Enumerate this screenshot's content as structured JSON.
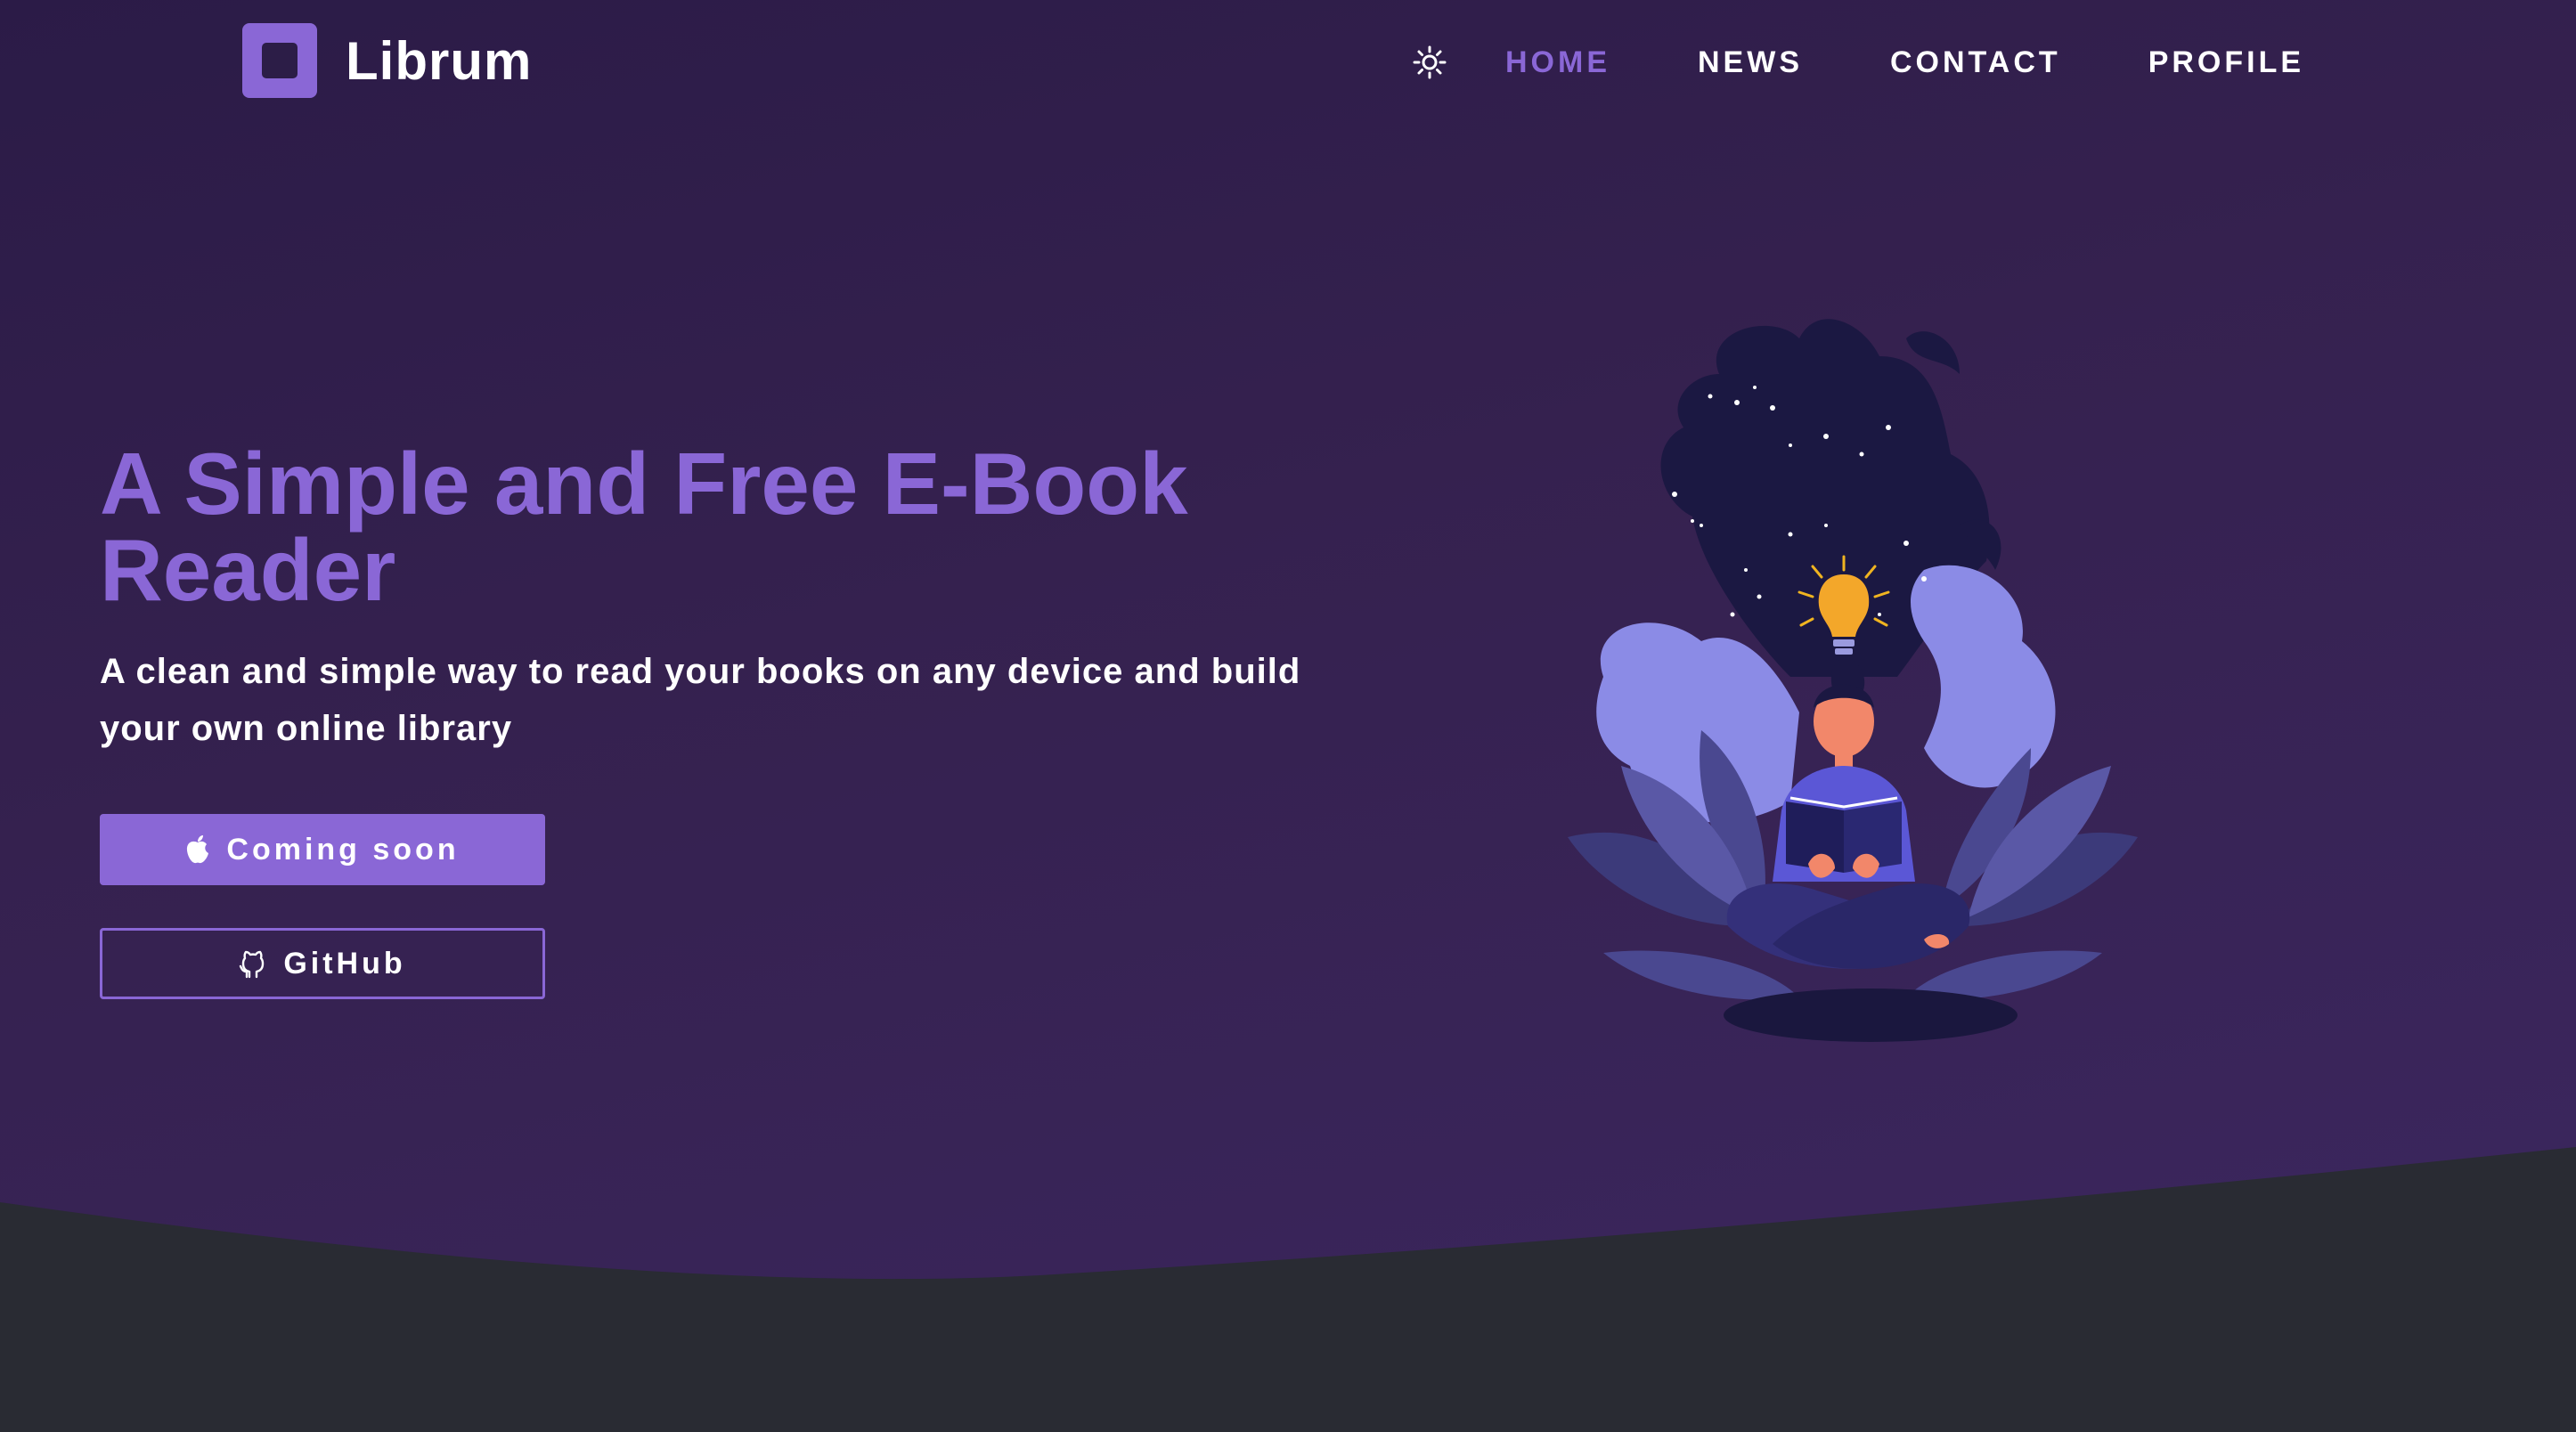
{
  "header": {
    "brand": "Librum",
    "nav": [
      {
        "label": "HOME",
        "active": true
      },
      {
        "label": "NEWS",
        "active": false
      },
      {
        "label": "CONTACT",
        "active": false
      },
      {
        "label": "PROFILE",
        "active": false
      }
    ],
    "theme_toggle_icon": "sun-icon"
  },
  "hero": {
    "title_line1": "A Simple and Free E-Book",
    "title_line2": "Reader",
    "subtitle_line1": "A clean and simple way to read your books on any device and build",
    "subtitle_line2": "your own online library",
    "primary_button": {
      "label": "Coming soon",
      "icon": "apple-icon"
    },
    "secondary_button": {
      "label": "GitHub",
      "icon": "github-icon"
    }
  },
  "colors": {
    "accent": "#8a67d6",
    "background_top": "#2b1b47",
    "background_bottom": "#3c2760",
    "footer": "#292b33",
    "text": "#ffffff"
  }
}
